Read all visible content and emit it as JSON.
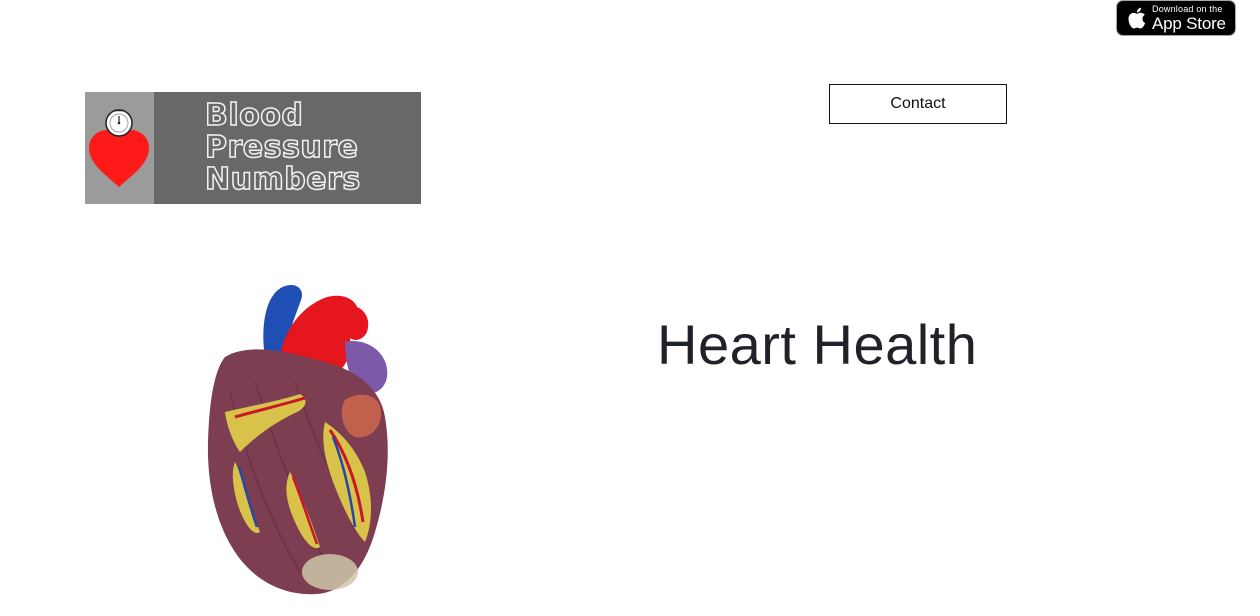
{
  "app_store_badge": {
    "small_text": "Download on the",
    "big_text": "App Store",
    "icon": "apple-icon"
  },
  "logo": {
    "lines": [
      "Blood",
      "Pressure",
      "Numbers"
    ],
    "icon": "heart-gauge-icon"
  },
  "nav": {
    "contact_label": "Contact"
  },
  "hero": {
    "image": "anatomical-heart-model",
    "title": "Heart Health"
  },
  "colors": {
    "logo_bg": "#686868",
    "logo_panel": "#9b9b9b",
    "heart_red": "#ff1a1a",
    "heading_text": "#1f2329"
  }
}
